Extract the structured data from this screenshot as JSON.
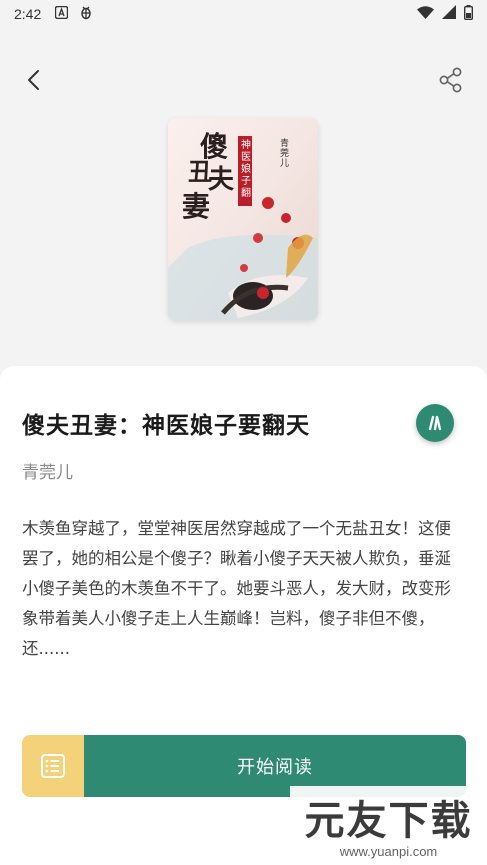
{
  "status_bar": {
    "time": "2:42",
    "icons": [
      "sim-a-icon",
      "bug-icon",
      "wifi-icon",
      "signal-icon",
      "battery-icon"
    ]
  },
  "nav": {
    "back_icon": "chevron-left-icon",
    "share_icon": "share-icon"
  },
  "cover": {
    "title_art": "傻夫丑妻",
    "subtitle_art": "神医娘子要翻天",
    "author_art": "青莞儿"
  },
  "book": {
    "title": "傻夫丑妻：神医娘子要翻天",
    "author": "青莞儿",
    "description": "木羡鱼穿越了，堂堂神医居然穿越成了一个无盐丑女！这便罢了，她的相公是个傻子？瞅着小傻子天天被人欺负，垂涎小傻子美色的木羡鱼不干了。她要斗恶人，发大财，改变形象带着美人小傻子走上人生巅峰！岂料，傻子非但不傻，还......"
  },
  "actions": {
    "toc_icon": "list-icon",
    "start_reading": "开始阅读"
  },
  "watermark": {
    "brand": "元友下载",
    "url": "www.yuanpi.com"
  },
  "colors": {
    "accent": "#2e8a72",
    "toc": "#f3d27a",
    "background": "#f3f3f3"
  }
}
